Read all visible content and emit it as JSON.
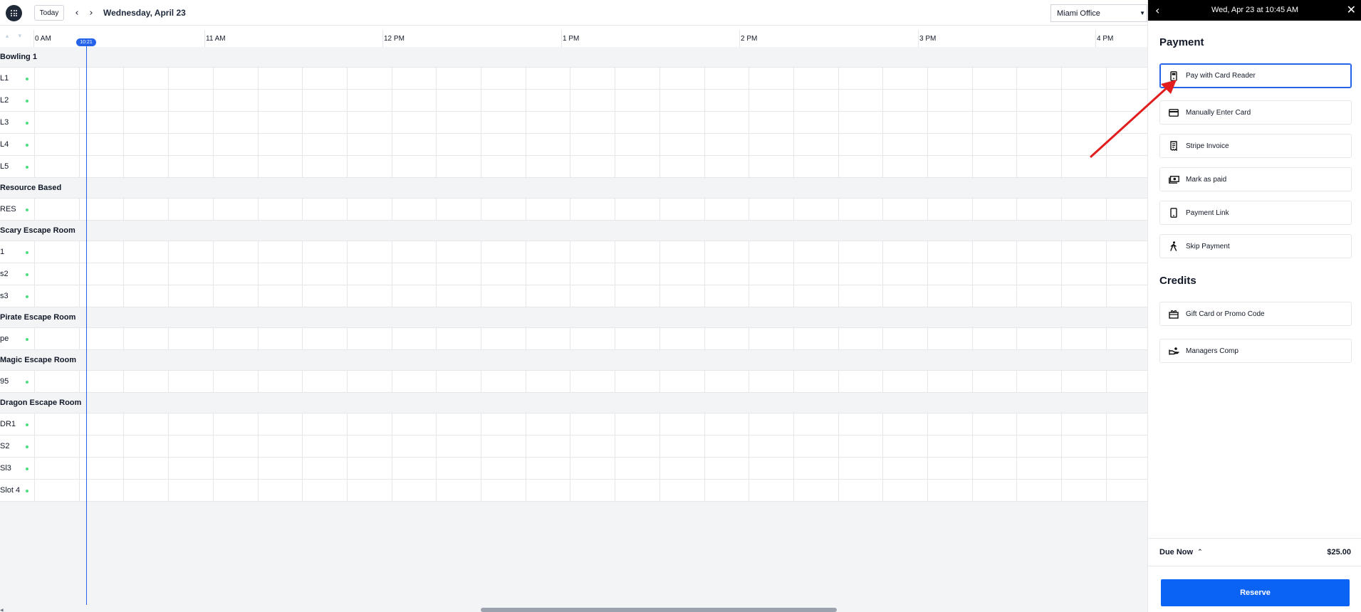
{
  "toolbar": {
    "today_label": "Today",
    "prev_icon": "chevron-left-icon",
    "next_icon": "chevron-right-icon",
    "date_title": "Wednesday, April 23",
    "location": "Miami Office"
  },
  "timeline": {
    "now_label": "10:21",
    "hours": [
      {
        "label": "0 AM"
      },
      {
        "label": "11 AM"
      },
      {
        "label": "12 PM"
      },
      {
        "label": "1 PM"
      },
      {
        "label": "2 PM"
      },
      {
        "label": "3 PM"
      },
      {
        "label": "4 PM"
      }
    ]
  },
  "groups": [
    {
      "name": "Bowling 1",
      "resources": [
        "L1",
        "L2",
        "L3",
        "L4",
        "L5"
      ]
    },
    {
      "name": "Resource Based",
      "resources": [
        "RES"
      ]
    },
    {
      "name": "Scary Escape Room",
      "resources": [
        "1",
        "s2",
        "s3"
      ]
    },
    {
      "name": "Pirate Escape Room",
      "resources": [
        "pe"
      ]
    },
    {
      "name": "Magic Escape Room",
      "resources": [
        "95"
      ]
    },
    {
      "name": "Dragon Escape Room",
      "resources": [
        "DR1",
        "S2",
        "Sl3",
        "Slot 4"
      ]
    }
  ],
  "panel": {
    "header_title": "Wed, Apr 23 at 10:45 AM",
    "payment_title": "Payment",
    "payment_options": [
      {
        "label": "Pay with Card Reader",
        "icon": "card-reader-icon",
        "selected": true
      },
      {
        "label": "Manually Enter Card",
        "icon": "credit-card-icon",
        "selected": false
      },
      {
        "label": "Stripe Invoice",
        "icon": "invoice-icon",
        "selected": false
      },
      {
        "label": "Mark as paid",
        "icon": "cash-icon",
        "selected": false
      },
      {
        "label": "Payment Link",
        "icon": "phone-icon",
        "selected": false
      },
      {
        "label": "Skip Payment",
        "icon": "walking-icon",
        "selected": false
      }
    ],
    "credits_title": "Credits",
    "credit_options": [
      {
        "label": "Gift Card or Promo Code",
        "icon": "gift-icon"
      },
      {
        "label": "Managers Comp",
        "icon": "comp-hand-icon"
      }
    ],
    "due_label": "Due Now",
    "due_amount": "$25.00",
    "reserve_label": "Reserve"
  },
  "colors": {
    "accent": "#0b63f6",
    "now_line": "#2563eb",
    "status_dot": "#4ade80",
    "annotation_arrow": "#e11d1d"
  }
}
